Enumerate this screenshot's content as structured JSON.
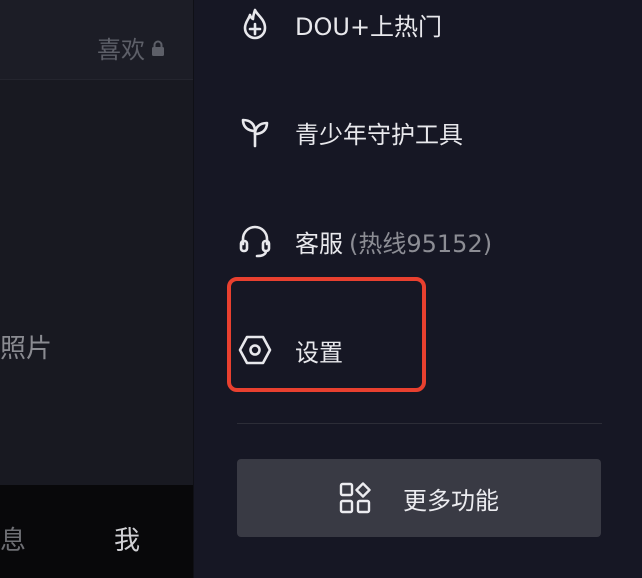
{
  "left_panel": {
    "likes_tab": "喜欢",
    "photo_text": "照片",
    "nav_messages": "息",
    "nav_me": "我"
  },
  "drawer": {
    "items": [
      {
        "label": "DOU+上热门",
        "icon": "flame-plus-icon"
      },
      {
        "label": "青少年守护工具",
        "icon": "sprout-icon"
      },
      {
        "label": "客服",
        "sub": "(热线95152)",
        "icon": "headset-icon"
      },
      {
        "label": "设置",
        "icon": "hexagon-settings-icon"
      }
    ],
    "more_button": {
      "label": "更多功能",
      "icon": "grid-shapes-icon"
    }
  },
  "colors": {
    "drawer_bg": "#161724",
    "highlight": "#e8402f",
    "button_bg": "#393a44"
  }
}
